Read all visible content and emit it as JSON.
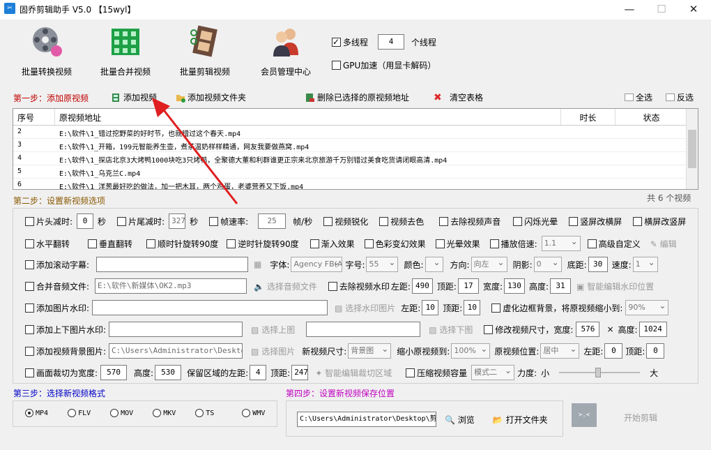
{
  "window": {
    "title": "固乔剪辑助手 V5.0  【15wyl】",
    "app_icon_glyph": "✂",
    "minimize": "—",
    "maximize": "☐",
    "close": "✕"
  },
  "toolbar": {
    "batch_convert": "批量转换视频",
    "batch_merge": "批量合并视频",
    "batch_edit": "批量剪辑视频",
    "member_center": "会员管理中心",
    "multithread_label": "多线程",
    "thread_count": "4",
    "thread_unit": "个线程",
    "gpu_label": "GPU加速（用显卡解码）"
  },
  "step1": {
    "title": "第一步：添加原视频",
    "add_video": "添加视频",
    "add_folder": "添加视频文件夹",
    "delete_selected": "删除已选择的原视频地址",
    "clear_table": "清空表格",
    "select_all": "全选",
    "invert": "反选"
  },
  "table": {
    "columns": [
      "序号",
      "原视频地址",
      "时长",
      "状态"
    ],
    "rows": [
      {
        "no": "2",
        "path": "E:\\软件\\1_错过挖野菜的好时节，也就错过这个春天.mp4"
      },
      {
        "no": "3",
        "path": "E:\\软件\\1_开箱，199元智能养生壶，煮茶温奶样样精通，网友我要做燕窝.mp4"
      },
      {
        "no": "4",
        "path": "E:\\软件\\1_探店北京3大烤鸭1000块吃3只烤鸭，全聚德大董和利群谁更正宗来北京旅游千万别错过美食吃货请闭眼高清.mp4"
      },
      {
        "no": "5",
        "path": "E:\\软件\\1_乌克兰C.mp4"
      },
      {
        "no": "6",
        "path": "E:\\软件\\1_洋葱最好吃的做法，加一把木耳，两个鸡蛋，老婆营养又下饭.mp4"
      }
    ],
    "total": "共 6 个视频"
  },
  "step2": {
    "title": "第二步：设置新视频选项",
    "head_cut": "片头减时:",
    "head_val": "0",
    "head_unit": "秒",
    "tail_cut": "片尾减时:",
    "tail_val": "327",
    "tail_unit": "秒",
    "frame_rate": "帧速率:",
    "frame_val": "25",
    "frame_unit": "帧/秒",
    "sharpen": "视频锐化",
    "decolor": "视频去色",
    "mute": "去除视频声音",
    "flash": "闪烁光晕",
    "v2h": "竖屏改横屏",
    "h2v": "横屏改竖屏",
    "hflip": "水平翻转",
    "vflip": "垂直翻转",
    "rot_cw": "顺时针旋转90度",
    "rot_ccw": "逆时针旋转90度",
    "fade_in": "渐入效果",
    "color_shift": "色彩变幻效果",
    "halo": "光晕效果",
    "speed": "播放倍速:",
    "speed_val": "1.1",
    "advanced": "高级自定义",
    "edit": "编辑",
    "scroll_sub": "添加滚动字幕:",
    "font_label": "字体:",
    "font_val": "Agency FB(AG",
    "size_label": "字号:",
    "size_val": "55",
    "color_label": "颜色:",
    "dir_label": "方向:",
    "dir_val": "向左",
    "shadow_label": "阴影:",
    "shadow_val": "0",
    "bottom_label": "底距:",
    "bottom_val": "30",
    "speed2_label": "速度:",
    "speed2_val": "1",
    "merge_audio": "合并音频文件:",
    "audio_path": "E:\\软件\\新媒体\\OK2.mp3",
    "choose_audio": "选择音频文件",
    "remove_wm": "去除视频水印",
    "left_label": "左距:",
    "wm_left": "490",
    "top_label": "顶距:",
    "wm_top": "17",
    "width_label": "宽度:",
    "wm_width": "130",
    "height_label": "高度:",
    "wm_height": "31",
    "smart_wm": "智能编辑水印位置",
    "img_wm": "添加图片水印:",
    "choose_wm_img": "选择水印图片",
    "img_left": "10",
    "img_top": "10",
    "blur_bg": "虚化边框背景，将原视频缩小到:",
    "blur_val": "90%",
    "tb_img_wm": "添加上下图片水印:",
    "choose_top": "选择上图",
    "choose_bottom": "选择下图",
    "resize": "修改视频尺寸，宽度:",
    "resize_w": "576",
    "times": "×",
    "height2_label": "高度:",
    "resize_h": "1024",
    "bg_img": "添加视频背景图片:",
    "bg_path": "C:\\Users\\Administrator\\Desktop\\背",
    "choose_img": "选择图片",
    "new_size": "新视频尺寸:",
    "new_size_val": "背景图",
    "shrink": "缩小原视频到:",
    "shrink_val": "100%",
    "pos_label": "原视频位置:",
    "pos_val": "居中",
    "bg_left": "0",
    "bg_top": "0",
    "crop": "画面裁切为宽度:",
    "crop_w": "570",
    "crop_h": "530",
    "keep_left": "保留区域的左距:",
    "crop_left": "4",
    "crop_top": "247",
    "smart_crop": "智能编辑裁切区域",
    "compress": "压缩视频容量",
    "compress_val": "模式二",
    "strength": "力度:",
    "small": "小",
    "big": "大"
  },
  "step3": {
    "title": "第三步：选择新视频格式",
    "formats": [
      "MP4",
      "FLV",
      "MOV",
      "MKV",
      "TS",
      "WMV"
    ]
  },
  "step4": {
    "title": "第四步：设置新视频保存位置",
    "path": "C:\\Users\\Administrator\\Desktop\\剪",
    "browse": "浏览",
    "open_folder": "打开文件夹",
    "start": "开始剪辑",
    "start_icon_text": ">.<"
  },
  "colors": {
    "step1": "#c00000",
    "step2": "#8a5800",
    "step3": "#0000c8",
    "step4": "#c000c0",
    "arrow": "#e02020"
  }
}
